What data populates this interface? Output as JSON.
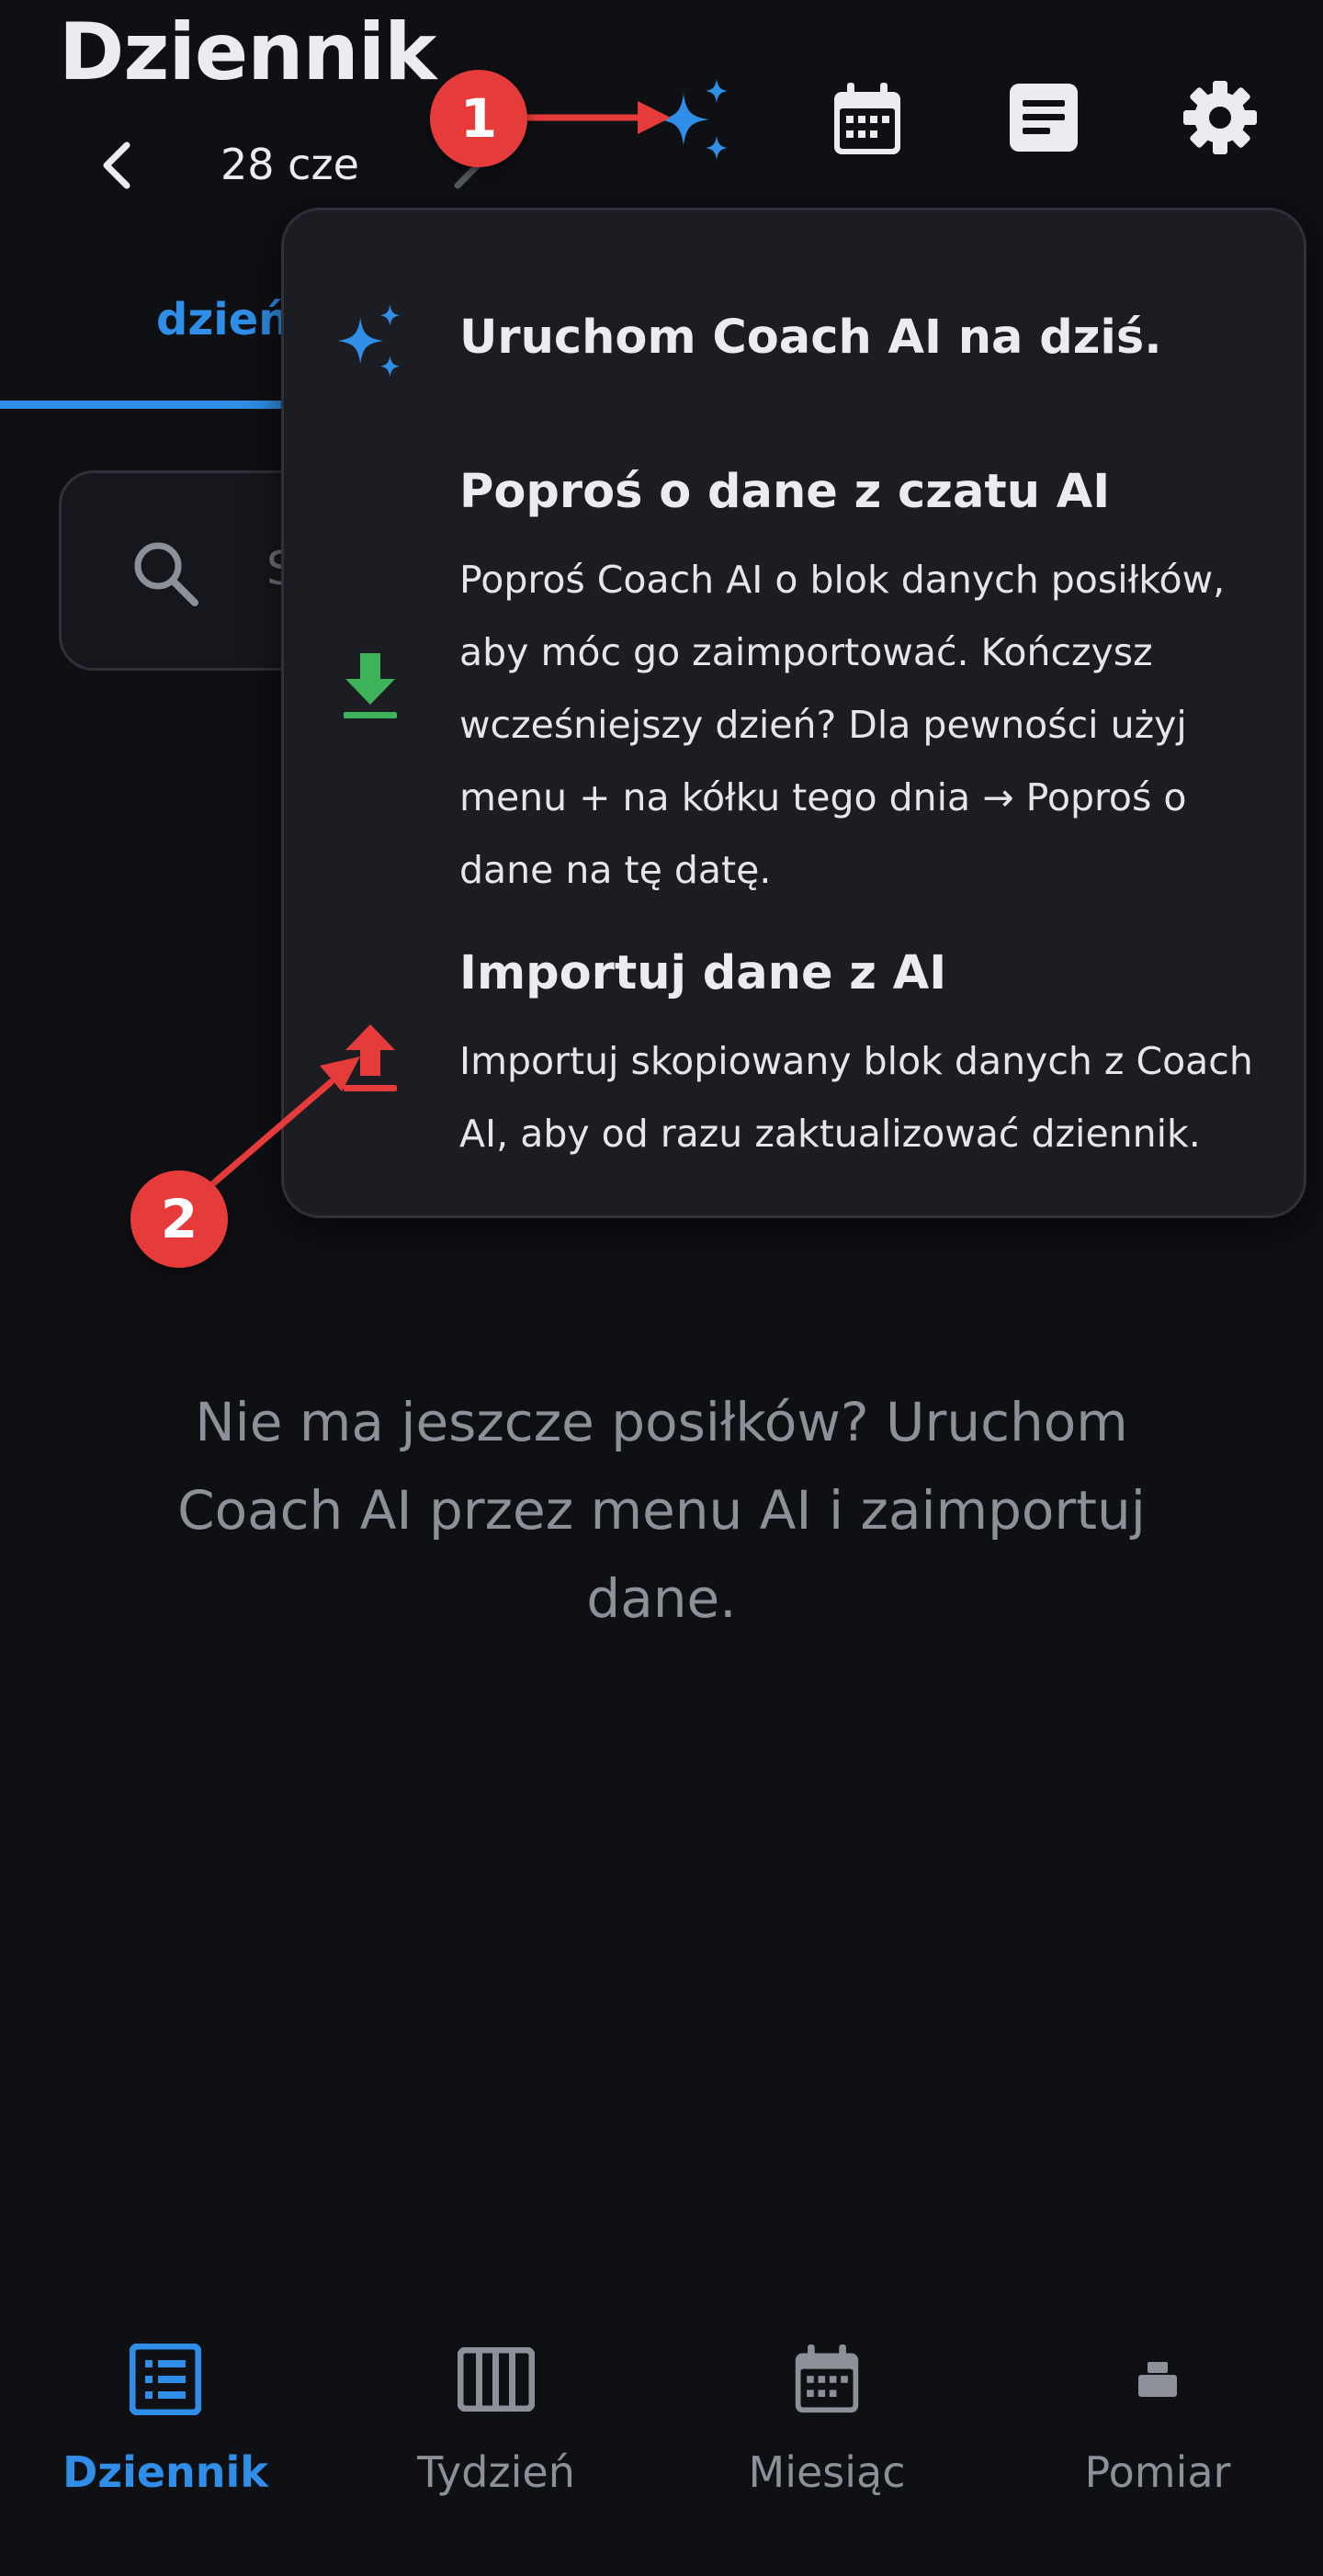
{
  "header": {
    "title": "Dziennik",
    "date": "28 cze",
    "icons": [
      "ai-sparkles-icon",
      "calendar-icon",
      "notes-icon",
      "settings-icon"
    ]
  },
  "tabs": {
    "active_label": "dzień"
  },
  "search": {
    "placeholder": "S"
  },
  "ai_menu": {
    "items": [
      {
        "title": "Uruchom Coach AI na dziś.",
        "description": "",
        "icon": "sparkles-icon"
      },
      {
        "title": "Poproś o dane z czatu AI",
        "description": "Poproś Coach AI o blok danych posiłków, aby móc go zaimportować. Kończysz wcześniejszy dzień? Dla pewności użyj menu + na kółku tego dnia → Poproś o dane na tę datę.",
        "icon": "download-icon"
      },
      {
        "title": "Importuj dane z AI",
        "description": "Importuj skopiowany blok danych z Coach AI, aby od razu zaktualizować dziennik.",
        "icon": "upload-icon"
      }
    ]
  },
  "empty_state": {
    "message": "Nie ma jeszcze posiłków? Uruchom Coach AI przez menu AI i zaimportuj dane."
  },
  "annotations": {
    "badge_1": "1",
    "badge_2": "2"
  },
  "bottom_nav": {
    "items": [
      {
        "label": "Dziennik",
        "active": true,
        "icon": "journal-list-icon"
      },
      {
        "label": "Tydzień",
        "active": false,
        "icon": "week-columns-icon"
      },
      {
        "label": "Miesiąc",
        "active": false,
        "icon": "month-calendar-icon"
      },
      {
        "label": "Pomiar",
        "active": false,
        "icon": "scale-icon"
      }
    ]
  },
  "colors": {
    "background": "#0f1014",
    "accent": "#2f8ee8",
    "download_green": "#3fb35a",
    "upload_red": "#e63b3b",
    "annotation_red": "#e63b3b",
    "inactive": "#8d8f99"
  }
}
